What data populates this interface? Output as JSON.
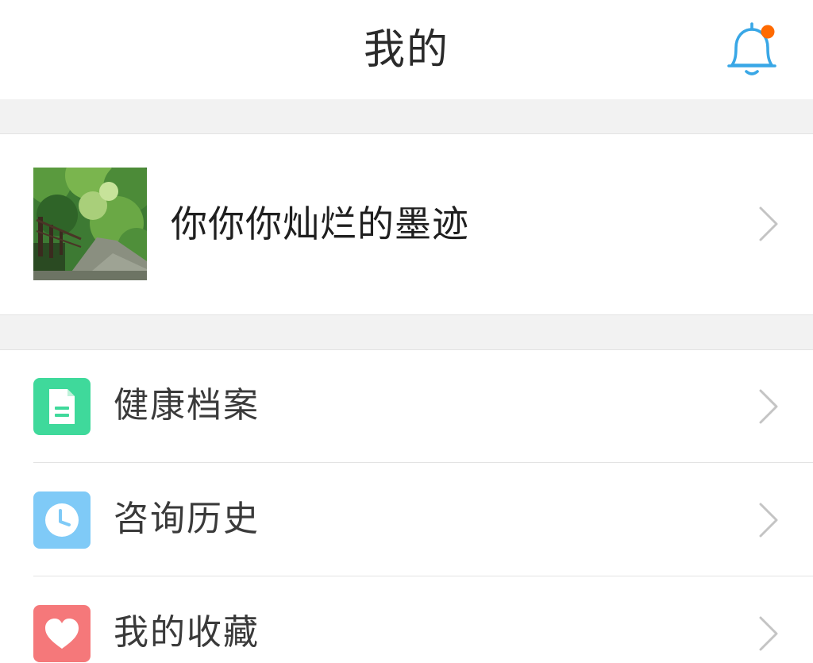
{
  "header": {
    "title": "我的",
    "notification_dot_color": "#ff6a00",
    "bell_color": "#39a7e6"
  },
  "profile": {
    "username": "你你你灿烂的墨迹",
    "avatar": "forest-path-photo"
  },
  "menu": {
    "items": [
      {
        "label": "健康档案",
        "icon": "document-icon",
        "icon_bg": "#3fd99b"
      },
      {
        "label": "咨询历史",
        "icon": "clock-icon",
        "icon_bg": "#7fcaf7"
      },
      {
        "label": "我的收藏",
        "icon": "heart-icon",
        "icon_bg": "#f5787a"
      }
    ]
  }
}
